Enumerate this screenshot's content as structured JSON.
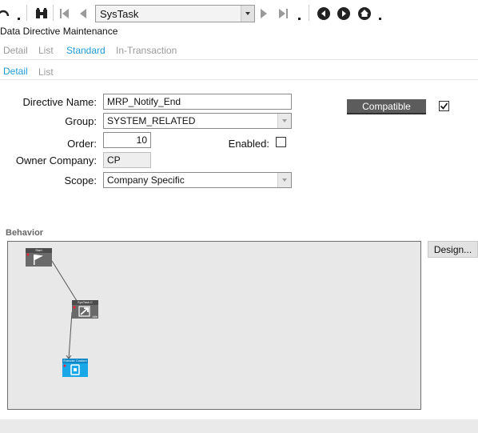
{
  "toolbar": {
    "navigation_value": "SysTask",
    "icons": [
      "refresh-icon",
      "binoculars-icon",
      "first-icon",
      "prev-icon",
      "next-icon",
      "last-icon",
      "back-icon",
      "forward-icon",
      "home-icon"
    ]
  },
  "header": {
    "title": "Data Directive Maintenance"
  },
  "tabs_primary": [
    "Detail",
    "List",
    "Standard",
    "In-Transaction"
  ],
  "tabs_secondary": [
    "Detail",
    "List"
  ],
  "form": {
    "directive_name_label": "Directive Name:",
    "directive_name_value": "MRP_Notify_End",
    "group_label": "Group:",
    "group_value": "SYSTEM_RELATED",
    "order_label": "Order:",
    "order_value": "10",
    "enabled_label": "Enabled:",
    "enabled_checked": false,
    "owner_company_label": "Owner Company:",
    "owner_company_value": "CP",
    "scope_label": "Scope:",
    "scope_value": "Company Specific",
    "compatible_label": "Compatible",
    "compatible_checked": true
  },
  "behavior": {
    "section_title": "Behavior",
    "design_button": "Design...",
    "nodes": [
      {
        "title": "Start",
        "color": "#6a6a6a"
      },
      {
        "title": "SysTask C",
        "sub": "Idle",
        "color": "#6a6a6a"
      },
      {
        "title": "Execute Custom C",
        "color": "#1aa7e8"
      }
    ]
  },
  "colors": {
    "accent": "#1e9bd7",
    "button_dark": "#5c5c5c",
    "canvas": "#e8e8e8"
  }
}
